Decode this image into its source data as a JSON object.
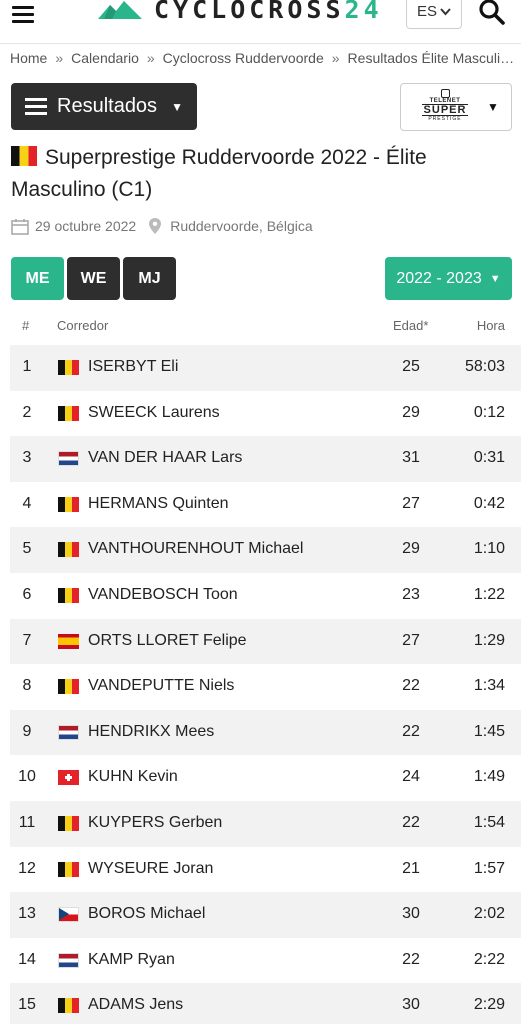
{
  "header": {
    "logo_text": "CYCLOCROSS",
    "logo_number": "24",
    "language": "ES",
    "colors": {
      "accent": "#2bb58b",
      "dark_button": "#2e2e2e"
    }
  },
  "breadcrumb": [
    "Home",
    "Calendario",
    "Cyclocross Ruddervoorde",
    "Resultados Élite Masculino (C1)"
  ],
  "results_menu": {
    "label": "Resultados"
  },
  "sponsor": {
    "line1": "TELENET",
    "line2": "SUPER",
    "line3": "PRESTIGE"
  },
  "race": {
    "title": "Superprestige Ruddervoorde 2022 - Élite Masculino (C1)",
    "date": "29 octubre 2022",
    "location": "Ruddervoorde, Bélgica"
  },
  "categories": [
    {
      "label": "ME",
      "active": true
    },
    {
      "label": "WE",
      "active": false
    },
    {
      "label": "MJ",
      "active": false
    }
  ],
  "season": {
    "label": "2022 - 2023"
  },
  "table": {
    "headers": {
      "pos": "#",
      "rider": "Corredor",
      "age": "Edad*",
      "time": "Hora"
    },
    "rows": [
      {
        "pos": "1",
        "flag": "be",
        "name": "ISERBYT Eli",
        "age": "25",
        "time": "58:03"
      },
      {
        "pos": "2",
        "flag": "be",
        "name": "SWEECK Laurens",
        "age": "29",
        "time": "0:12"
      },
      {
        "pos": "3",
        "flag": "nl",
        "name": "VAN DER HAAR Lars",
        "age": "31",
        "time": "0:31"
      },
      {
        "pos": "4",
        "flag": "be",
        "name": "HERMANS Quinten",
        "age": "27",
        "time": "0:42"
      },
      {
        "pos": "5",
        "flag": "be",
        "name": "VANTHOURENHOUT Michael",
        "age": "29",
        "time": "1:10"
      },
      {
        "pos": "6",
        "flag": "be",
        "name": "VANDEBOSCH Toon",
        "age": "23",
        "time": "1:22"
      },
      {
        "pos": "7",
        "flag": "es",
        "name": "ORTS LLORET Felipe",
        "age": "27",
        "time": "1:29"
      },
      {
        "pos": "8",
        "flag": "be",
        "name": "VANDEPUTTE Niels",
        "age": "22",
        "time": "1:34"
      },
      {
        "pos": "9",
        "flag": "nl",
        "name": "HENDRIKX Mees",
        "age": "22",
        "time": "1:45"
      },
      {
        "pos": "10",
        "flag": "ch",
        "name": "KUHN Kevin",
        "age": "24",
        "time": "1:49"
      },
      {
        "pos": "11",
        "flag": "be",
        "name": "KUYPERS Gerben",
        "age": "22",
        "time": "1:54"
      },
      {
        "pos": "12",
        "flag": "be",
        "name": "WYSEURE Joran",
        "age": "21",
        "time": "1:57"
      },
      {
        "pos": "13",
        "flag": "cz",
        "name": "BOROS Michael",
        "age": "30",
        "time": "2:02"
      },
      {
        "pos": "14",
        "flag": "nl",
        "name": "KAMP Ryan",
        "age": "22",
        "time": "2:22"
      },
      {
        "pos": "15",
        "flag": "be",
        "name": "ADAMS Jens",
        "age": "30",
        "time": "2:29"
      }
    ]
  }
}
